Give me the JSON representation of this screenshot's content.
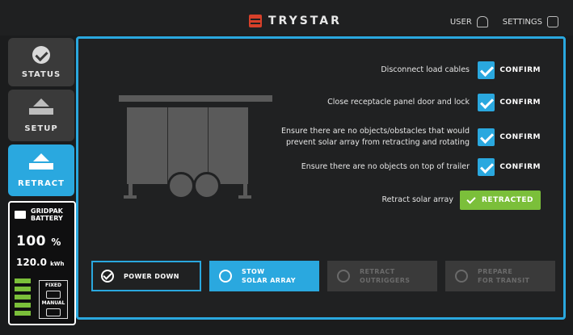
{
  "header": {
    "brand": "TRYSTAR",
    "user_label": "USER",
    "settings_label": "SETTINGS"
  },
  "sidebar": {
    "items": [
      {
        "label": "STATUS",
        "icon": "check-circle-icon"
      },
      {
        "label": "SETUP",
        "icon": "setup-icon"
      },
      {
        "label": "RETRACT",
        "icon": "retract-icon"
      }
    ]
  },
  "battery": {
    "title_line1": "GRIDPAK",
    "title_line2": "BATTERY",
    "percent": "100",
    "percent_unit": "%",
    "energy": "120.0",
    "energy_unit": "kWh",
    "panel_top": "FIXED",
    "panel_bottom": "MANUAL"
  },
  "checklist": {
    "items": [
      {
        "label": "Disconnect load cables",
        "action": "CONFIRM"
      },
      {
        "label": "Close receptacle panel door and lock",
        "action": "CONFIRM"
      },
      {
        "label_line1": "Ensure there are no objects/obstacles that would",
        "label_line2": "prevent solar array from retracting and rotating",
        "action": "CONFIRM"
      },
      {
        "label": "Ensure there are no objects on top of trailer",
        "action": "CONFIRM"
      },
      {
        "label": "Retract solar array",
        "action": "RETRACTED"
      }
    ]
  },
  "steps": [
    {
      "label": "POWER DOWN",
      "state": "done"
    },
    {
      "label_line1": "STOW",
      "label_line2": "SOLAR ARRAY",
      "state": "active"
    },
    {
      "label_line1": "RETRACT",
      "label_line2": "OUTRIGGERS",
      "state": "disabled"
    },
    {
      "label_line1": "PREPARE",
      "label_line2": "FOR TRANSIT",
      "state": "disabled"
    }
  ],
  "colors": {
    "accent": "#2aa8df",
    "success": "#7bbf3a",
    "background": "#1b1c1d",
    "brand_red": "#d6402a"
  }
}
